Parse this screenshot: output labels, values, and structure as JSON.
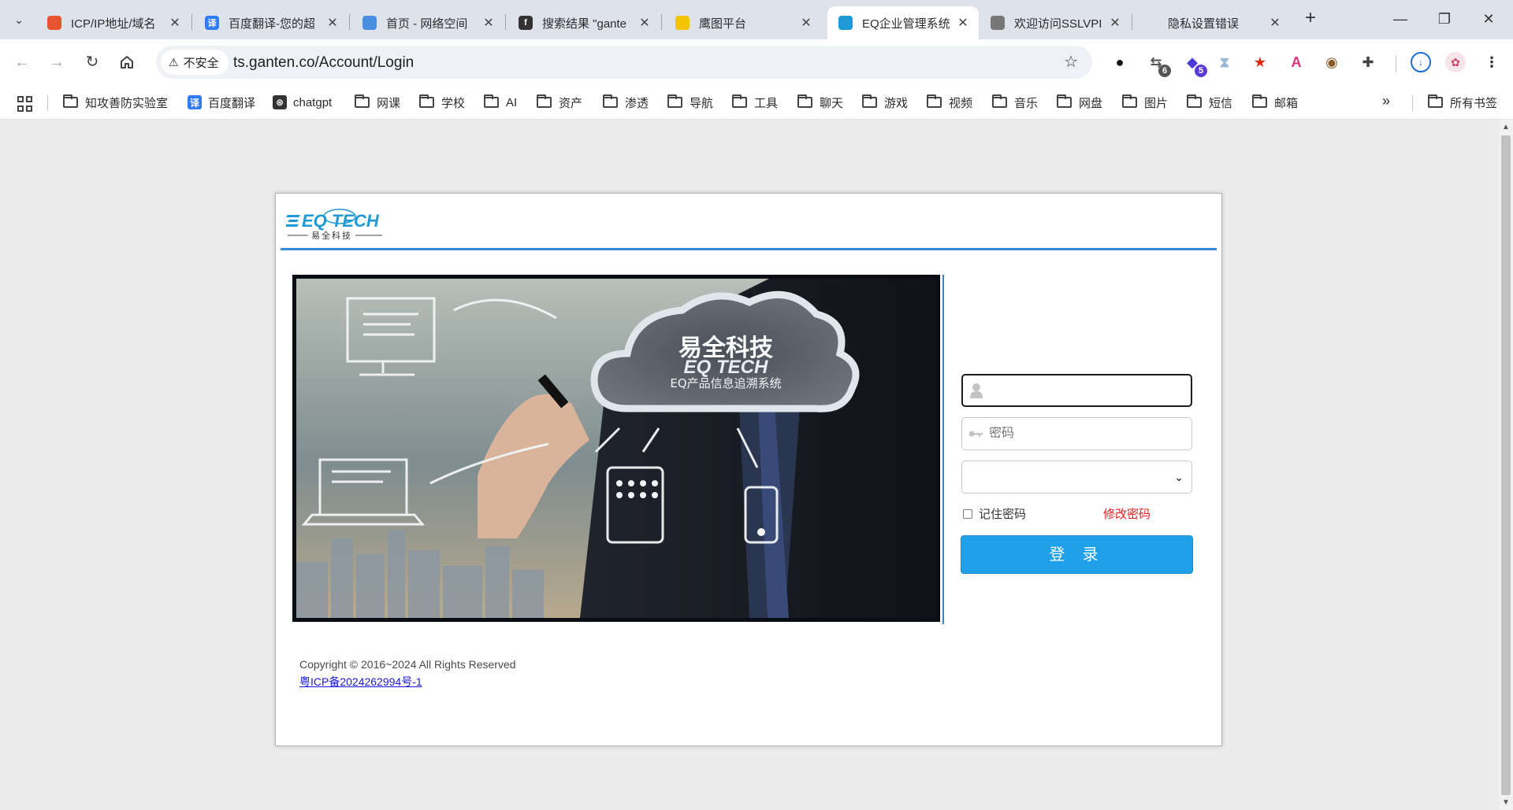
{
  "browser": {
    "tabs": [
      {
        "title": "ICP/IP地址/域名",
        "icon": "icp-favicon",
        "color": "#e8542e"
      },
      {
        "title": "百度翻译-您的超",
        "icon": "baidu-translate-favicon",
        "color": "#2f7cf6",
        "glyph": "译"
      },
      {
        "title": "首页 - 网络空间",
        "icon": "eye-favicon",
        "color": "#4a90e2"
      },
      {
        "title": "搜索结果 \"gante",
        "icon": "fofa-favicon",
        "color": "#333333",
        "glyph": "f"
      },
      {
        "title": "鹰图平台",
        "icon": "hunter-favicon",
        "color": "#f5c400"
      },
      {
        "title": "EQ企业管理系统",
        "icon": "eq-favicon",
        "color": "#1e9ad6",
        "active": true
      },
      {
        "title": "欢迎访问SSLVPI",
        "icon": "globe-favicon",
        "color": "#777777"
      },
      {
        "title": "隐私设置错误",
        "icon": "blank-favicon",
        "color": "#ffffff"
      }
    ],
    "url_prefix": "ts.ganten.co",
    "url_path": "/Account/Login",
    "security_label": "不安全",
    "extensions": [
      {
        "name": "circle-extension-icon",
        "color": "#111111"
      },
      {
        "name": "translate-extension-icon",
        "color": "#555555",
        "badge": "6",
        "badge_color": "#555555"
      },
      {
        "name": "shield-extension-icon",
        "color": "#4b3bd8",
        "badge": "5",
        "badge_color": "#5b3bd8"
      },
      {
        "name": "hourglass-extension-icon",
        "color": "#9ab8d8"
      },
      {
        "name": "china-flag-extension-icon",
        "color": "#de2910"
      },
      {
        "name": "magenta-extension-icon",
        "color": "#d8307a"
      },
      {
        "name": "cookie-extension-icon",
        "color": "#8a5a2b"
      },
      {
        "name": "puzzle-extension-icon",
        "color": "#444444"
      }
    ],
    "bookmarks": [
      {
        "label": "知攻善防实验室",
        "type": "folder"
      },
      {
        "label": "百度翻译",
        "type": "site",
        "glyph": "译",
        "color": "#2f7cf6"
      },
      {
        "label": "chatgpt",
        "type": "site",
        "glyph": "⊛",
        "color": "#333333"
      },
      {
        "label": "网课",
        "type": "folder"
      },
      {
        "label": "学校",
        "type": "folder"
      },
      {
        "label": "AI",
        "type": "folder"
      },
      {
        "label": "资产",
        "type": "folder"
      },
      {
        "label": "渗透",
        "type": "folder"
      },
      {
        "label": "导航",
        "type": "folder"
      },
      {
        "label": "工具",
        "type": "folder"
      },
      {
        "label": "聊天",
        "type": "folder"
      },
      {
        "label": "游戏",
        "type": "folder"
      },
      {
        "label": "视频",
        "type": "folder"
      },
      {
        "label": "音乐",
        "type": "folder"
      },
      {
        "label": "网盘",
        "type": "folder"
      },
      {
        "label": "图片",
        "type": "folder"
      },
      {
        "label": "短信",
        "type": "folder"
      },
      {
        "label": "邮箱",
        "type": "folder"
      }
    ],
    "overflow": "»",
    "all_bookmarks": "所有书签"
  },
  "login": {
    "logo_text": "EQ TECH",
    "logo_subtitle": "易全科技",
    "banner_title": "易全科技",
    "banner_brand": "EQ TECH",
    "banner_caption": "EQ产品信息追溯系统",
    "username_value": "",
    "password_placeholder": "密码",
    "select_value": "",
    "remember_label": "记住密码",
    "change_password": "修改密码",
    "login_button": "登 录",
    "copyright": "Copyright © 2016~2024 All Rights Reserved",
    "icp_link": "粤ICP备2024262994号-1"
  },
  "colors": {
    "accent": "#1fa0e9",
    "rule": "#3a87d4",
    "danger": "#e02020",
    "link": "#1a1ad6"
  }
}
